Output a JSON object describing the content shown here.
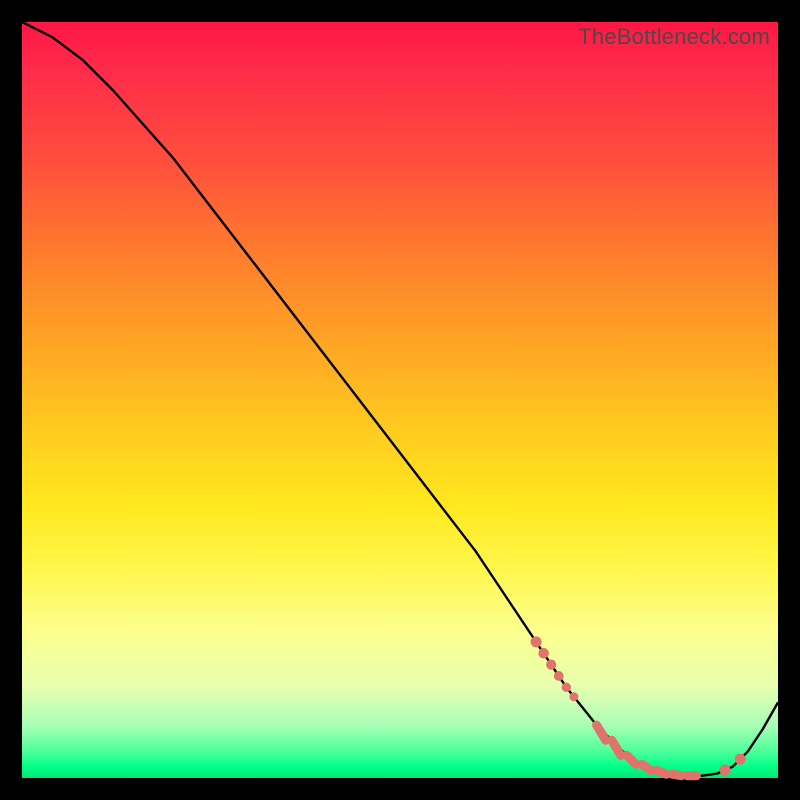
{
  "watermark": "TheBottleneck.com",
  "chart_data": {
    "type": "line",
    "title": "",
    "xlabel": "",
    "ylabel": "",
    "xlim": [
      0,
      100
    ],
    "ylim": [
      0,
      100
    ],
    "series": [
      {
        "name": "curve",
        "x": [
          0,
          4,
          8,
          12,
          20,
          30,
          40,
          50,
          60,
          68,
          72,
          76,
          80,
          82,
          84,
          86,
          88,
          90,
          92,
          94,
          96,
          98,
          100
        ],
        "y": [
          100,
          98,
          95,
          91,
          82,
          69,
          56,
          43,
          30,
          18,
          12,
          7,
          3,
          1.8,
          1.0,
          0.5,
          0.3,
          0.3,
          0.6,
          1.5,
          3.5,
          6.5,
          10
        ]
      }
    ],
    "highlights": {
      "left_cluster_x": [
        68,
        69,
        70,
        71,
        72,
        73
      ],
      "bottom_run_x": [
        76,
        78,
        80,
        82,
        84,
        86,
        88,
        90
      ],
      "right_pair_x": [
        93,
        95
      ]
    }
  }
}
